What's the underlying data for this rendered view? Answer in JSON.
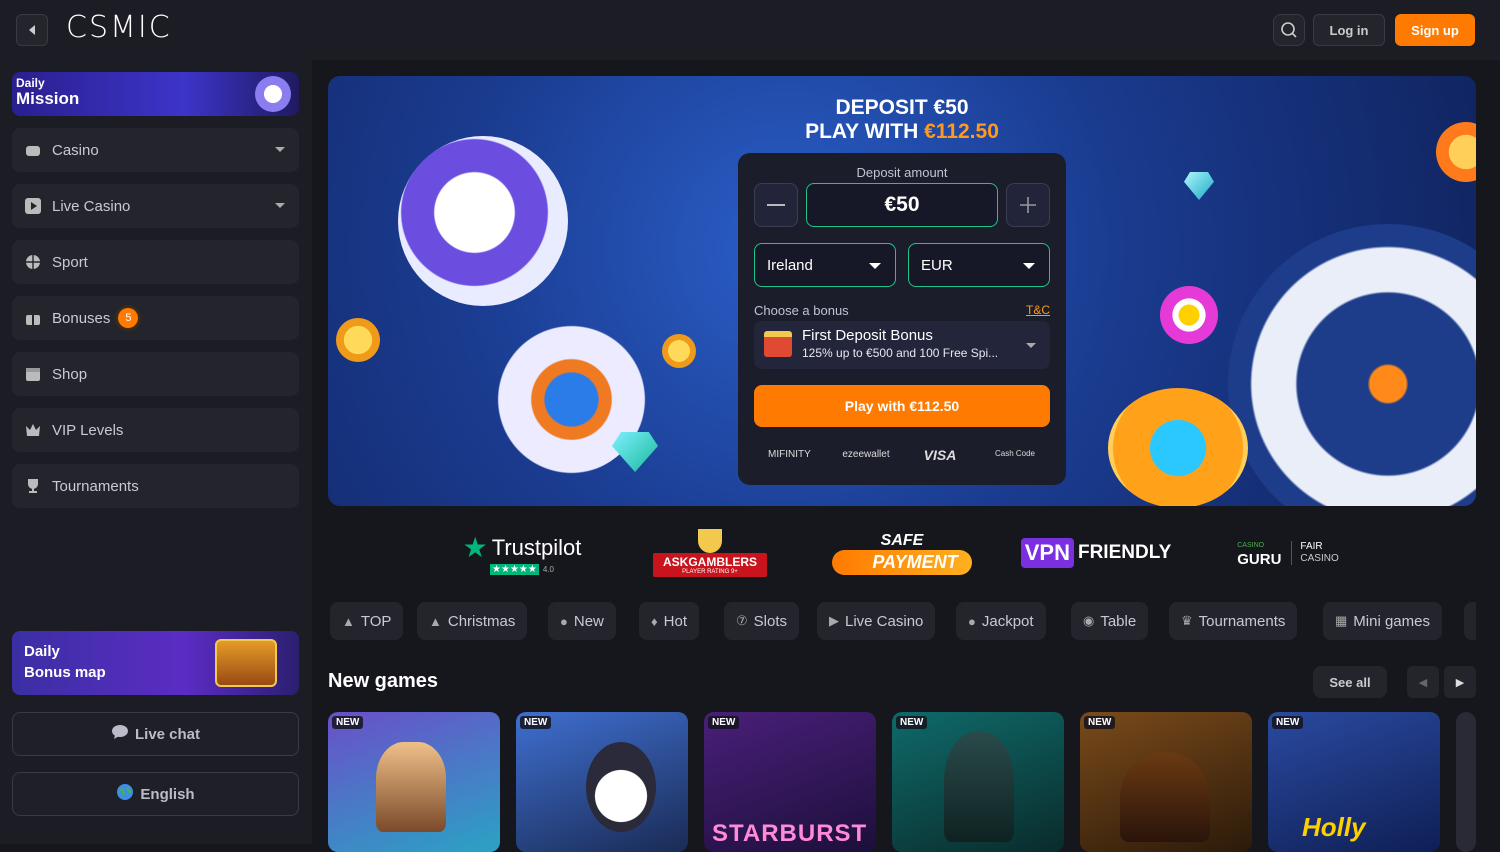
{
  "header": {
    "logo_text": "CSMIC",
    "login_label": "Log in",
    "signup_label": "Sign up",
    "accent": "#ff7a00"
  },
  "sidebar": {
    "daily_mission": {
      "line1": "Daily",
      "line2": "Mission"
    },
    "items": [
      {
        "label": "Casino",
        "icon": "gamepad-icon"
      },
      {
        "label": "Live Casino",
        "icon": "play-icon"
      },
      {
        "label": "Sport",
        "icon": "basketball-icon"
      },
      {
        "label": "Bonuses",
        "icon": "gift-icon",
        "badge": "5"
      },
      {
        "label": "Shop",
        "icon": "shop-icon"
      },
      {
        "label": "VIP Levels",
        "icon": "crown-icon"
      },
      {
        "label": "Tournaments",
        "icon": "trophy-icon"
      }
    ],
    "bonus_map": {
      "line1": "Daily",
      "line2": "Bonus map"
    },
    "live_chat_label": "Live chat",
    "language_label": "English"
  },
  "hero": {
    "title_line1": "DEPOSIT €50",
    "title_line2_prefix": "PLAY WITH ",
    "title_line2_value": "€112.50",
    "deposit_label": "Deposit amount",
    "amount": "€50",
    "country": "Ireland",
    "currency": "EUR",
    "choose_bonus_label": "Choose a bonus",
    "tc_label": "T&C",
    "bonus_title": "First Deposit Bonus",
    "bonus_desc": "125% up to €500 and 100 Free Spi...",
    "play_button": "Play with €112.50",
    "payment_methods": [
      "MIFINITY",
      "ezeewallet",
      "VISA",
      "Cash Code"
    ]
  },
  "trust": {
    "trustpilot": "Trustpilot",
    "trustpilot_score": "4.0",
    "askgamblers": "ASKGAMBLERS",
    "askgamblers_sub": "PLAYER RATING 9+",
    "safe": "SAFE",
    "payment": "PAYMENT",
    "vpn": "VPN",
    "friendly": "FRIENDLY",
    "casino": "CASINO",
    "guru": "GURU",
    "fair": "FAIR",
    "casino2": "CASINO"
  },
  "categories": [
    {
      "label": "TOP",
      "icon": "rocket-icon"
    },
    {
      "label": "Christmas",
      "icon": "tree-icon"
    },
    {
      "label": "New",
      "icon": "bell-icon"
    },
    {
      "label": "Hot",
      "icon": "flame-icon"
    },
    {
      "label": "Slots",
      "icon": "seven-icon"
    },
    {
      "label": "Live Casino",
      "icon": "play-icon"
    },
    {
      "label": "Jackpot",
      "icon": "coin-icon"
    },
    {
      "label": "Table",
      "icon": "chip-icon"
    },
    {
      "label": "Tournaments",
      "icon": "trophy-icon"
    },
    {
      "label": "Mini games",
      "icon": "grid-icon"
    }
  ],
  "new_games": {
    "title": "New games",
    "see_all": "See all",
    "badge": "NEW",
    "tiles": [
      {
        "name": "",
        "colors": [
          "#6a4fc9",
          "#2aa3c4"
        ]
      },
      {
        "name": "",
        "colors": [
          "#3f6fd0",
          "#1a2b55"
        ]
      },
      {
        "name": "STARBURST",
        "colors": [
          "#4a1f7a",
          "#1c0f3a"
        ]
      },
      {
        "name": "",
        "colors": [
          "#0f6a6a",
          "#0a2b2b"
        ]
      },
      {
        "name": "",
        "colors": [
          "#7a4a1a",
          "#2b1a0a"
        ]
      },
      {
        "name": "Holly",
        "colors": [
          "#2a4aa0",
          "#0f1f55"
        ]
      }
    ]
  }
}
